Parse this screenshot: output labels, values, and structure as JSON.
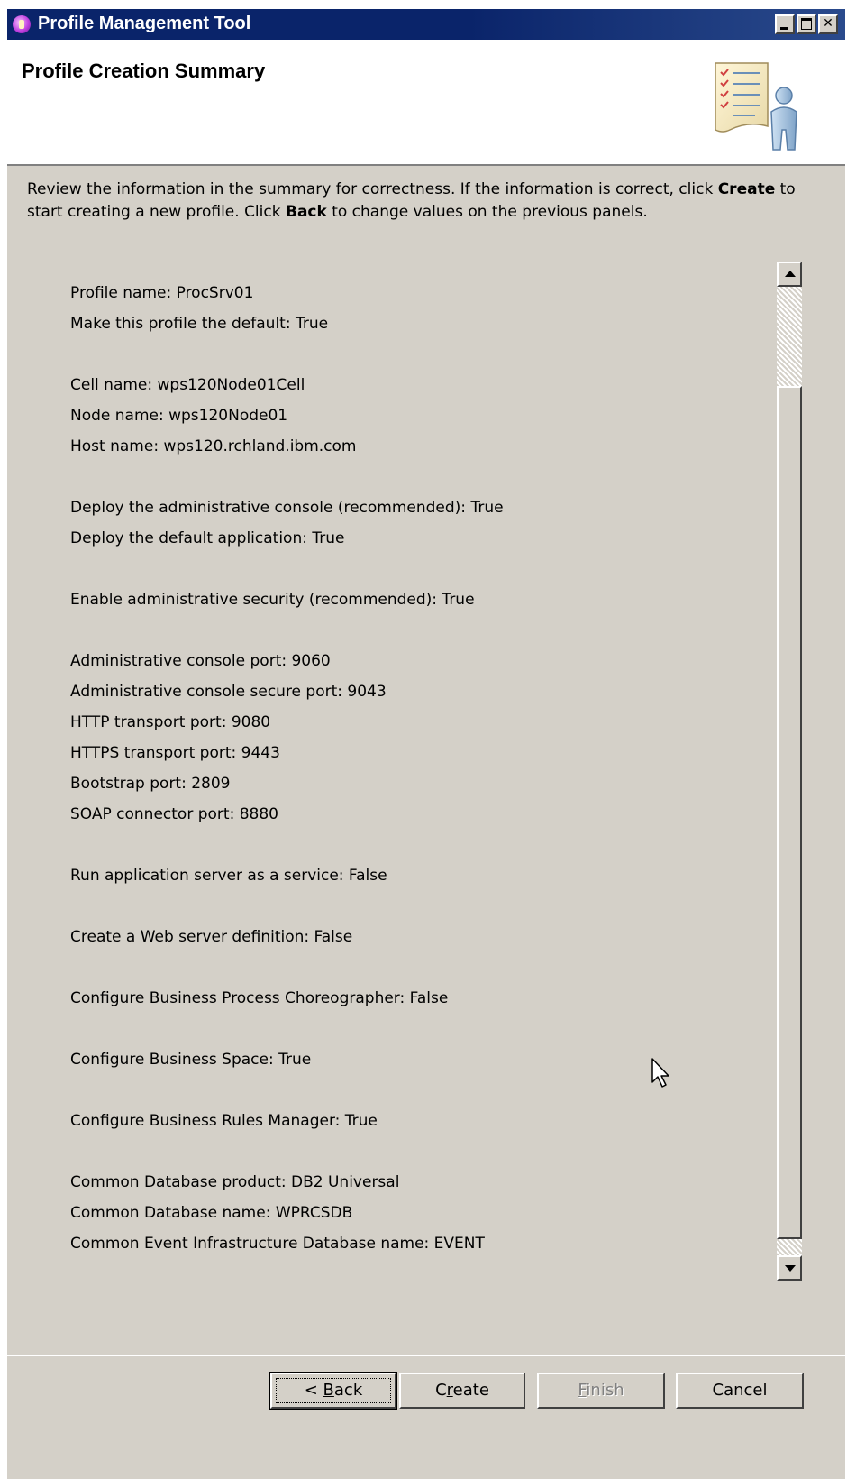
{
  "window": {
    "title": "Profile Management Tool"
  },
  "banner": {
    "title": "Profile Creation Summary"
  },
  "instructions": {
    "part1": "Review the information in the summary for correctness. If the information is correct, click ",
    "create_word": "Create",
    "part2": " to start creating a new profile. Click ",
    "back_word": "Back",
    "part3": " to change values on the previous panels."
  },
  "summary": {
    "lines": [
      "Profile name: ProcSrv01",
      "Make this profile the default: True",
      "Cell name: wps120Node01Cell",
      "Node name: wps120Node01",
      "Host name: wps120.rchland.ibm.com",
      "Deploy the administrative console (recommended): True",
      "Deploy the default application: True",
      "Enable administrative security (recommended): True",
      "Administrative console port: 9060",
      "Administrative console secure port: 9043",
      "HTTP transport port: 9080",
      "HTTPS transport port: 9443",
      "Bootstrap port: 2809",
      "SOAP connector port: 8880",
      "Run application server as a service: False",
      "Create a Web server definition: False",
      "Configure Business Process Choreographer: False",
      "Configure Business Space: True",
      "Configure Business Rules Manager: True",
      "Common Database product: DB2 Universal",
      "Common Database name: WPRCSDB",
      "Common Event Infrastructure Database name: EVENT"
    ]
  },
  "buttons": {
    "back_prefix": "< ",
    "back_mnemonic": "B",
    "back_rest": "ack",
    "create_prefix": "C",
    "create_mnemonic": "r",
    "create_rest": "eate",
    "finish_mnemonic": "F",
    "finish_rest": "inish",
    "cancel": "Cancel"
  },
  "icons": {
    "app": "profile-tool-icon",
    "banner": "summary-checklist-person-icon",
    "cursor": "mouse-pointer-icon"
  },
  "colors": {
    "titlebar": "#0a246a",
    "dialog_background": "#d4d0c8",
    "disabled_text": "#808080"
  }
}
